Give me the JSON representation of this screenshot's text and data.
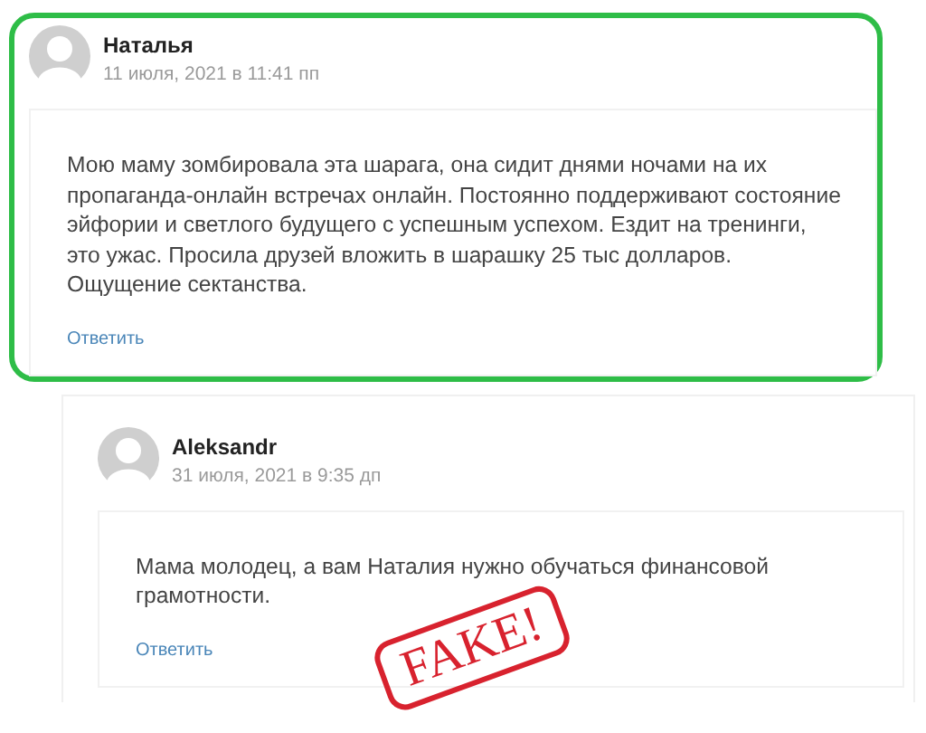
{
  "comments": [
    {
      "author": "Наталья",
      "date": "11 июля, 2021 в 11:41 пп",
      "text": "Мою маму зомбировала эта шарага, она сидит днями ночами на их пропаганда-онлайн встречах онлайн. Постоянно поддерживают состояние эйфории и светлого будущего с успешным успехом. Ездит на тренинги, это ужас. Просила друзей вложить в шарашку 25 тыс долларов. Ощущение сектанства.",
      "reply": "Ответить",
      "highlighted": true,
      "children": [
        {
          "author": "Aleksandr",
          "date": "31 июля, 2021 в 9:35 дп",
          "text": "Мама молодец, а вам Наталия нужно обучаться финансовой грамотности.",
          "reply": "Ответить",
          "highlighted": false
        }
      ]
    }
  ],
  "stamp": {
    "text": "FAKE!"
  }
}
